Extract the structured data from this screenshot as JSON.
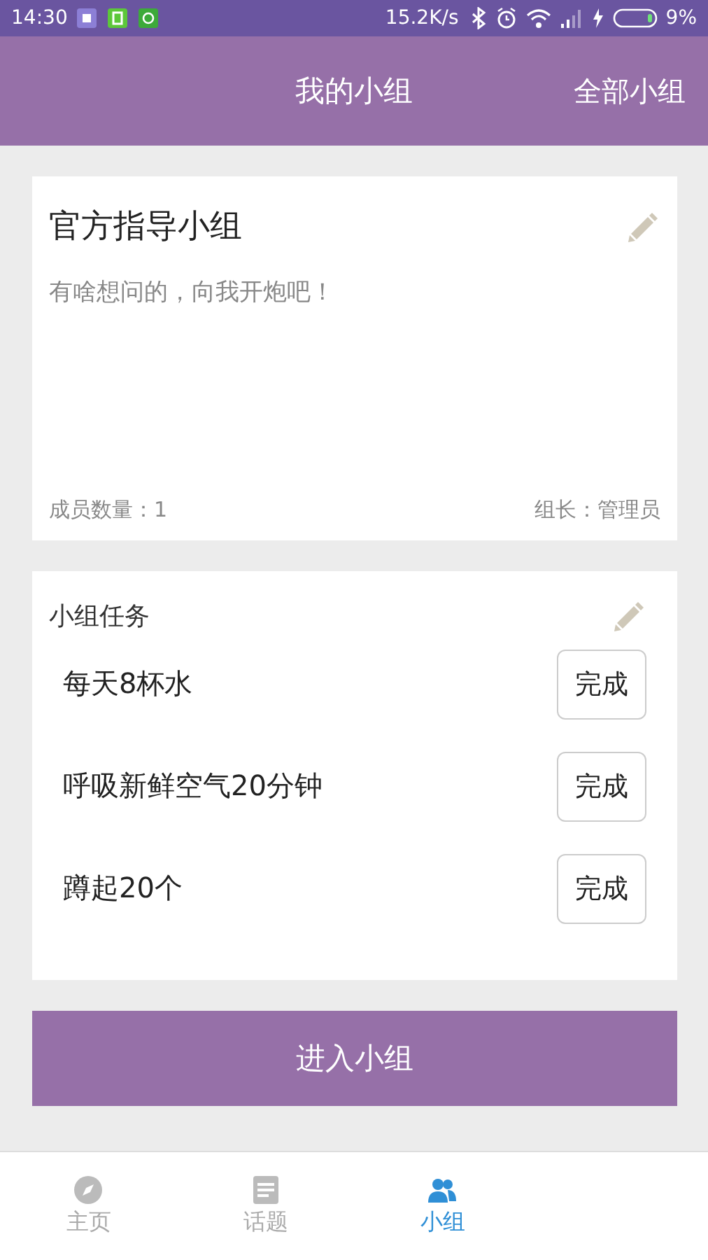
{
  "status_bar": {
    "time": "14:30",
    "network_speed": "15.2K/s",
    "battery": "9%"
  },
  "header": {
    "title": "我的小组",
    "action": "全部小组"
  },
  "group_card": {
    "name": "官方指导小组",
    "description": "有啥想问的，向我开炮吧！",
    "members": "成员数量：1",
    "leader": "组长：管理员"
  },
  "tasks_card": {
    "title": "小组任务",
    "tasks": [
      {
        "label": "每天8杯水",
        "button": "完成"
      },
      {
        "label": "呼吸新鲜空气20分钟",
        "button": "完成"
      },
      {
        "label": "蹲起20个",
        "button": "完成"
      }
    ]
  },
  "enter_button": "进入小组",
  "tab_bar": [
    {
      "label": "主页",
      "selected": false
    },
    {
      "label": "话题",
      "selected": false
    },
    {
      "label": "小组",
      "selected": true
    }
  ]
}
